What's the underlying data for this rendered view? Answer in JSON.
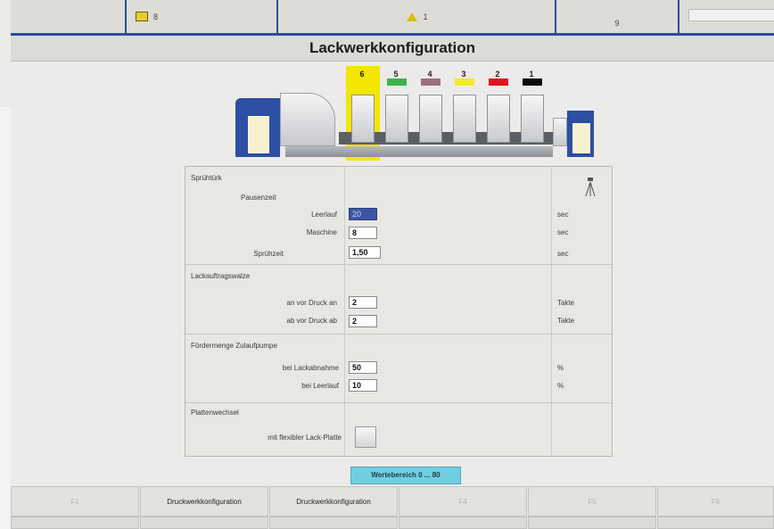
{
  "status_bar": {
    "folder_count": "8",
    "warning_count": "1",
    "counter": "9",
    "folder_icon": "folder-icon",
    "warning_icon": "warning-triangle-icon"
  },
  "page_title": "Lackwerkkonfiguration",
  "press": {
    "units": [
      {
        "number": "6",
        "color": "#f3e600",
        "active": true
      },
      {
        "number": "5",
        "color": "#3cb34a",
        "active": false
      },
      {
        "number": "4",
        "color": "#9c6f7c",
        "active": false
      },
      {
        "number": "3",
        "color": "#f5ea2a",
        "active": false
      },
      {
        "number": "2",
        "color": "#e3111f",
        "active": false
      },
      {
        "number": "1",
        "color": "#0a0a0a",
        "active": false
      }
    ]
  },
  "spray": {
    "header": "Sprühtürk",
    "pause_label": "Pausenzeit",
    "idle_label": "Leerlauf",
    "idle_value": "20",
    "idle_unit": "sec",
    "machine_label": "Maschine",
    "machine_value": "8",
    "machine_unit": "sec",
    "spray_time_label": "Sprühzeit",
    "spray_time_value": "1,50",
    "spray_time_unit": "sec",
    "icon": "spray-nozzle-icon"
  },
  "roller": {
    "header": "Lackauftragswalze",
    "on_label": "an vor Druck an",
    "on_value": "2",
    "on_unit": "Takte",
    "off_label": "ab vor Druck ab",
    "off_value": "2",
    "off_unit": "Takte"
  },
  "pump": {
    "header": "Fördermenge Zulaufpumpe",
    "take_label": "bei Lackabnahme",
    "take_value": "50",
    "take_unit": "%",
    "idle_label": "bei Leerlauf",
    "idle_value": "10",
    "idle_unit": "%"
  },
  "plate": {
    "header": "Plattenwechsel",
    "flex_label": "mit flexibler Lack-Platte"
  },
  "range_text": "Wertebereich 0 ... 80",
  "bottom_buttons": [
    {
      "label": "F1",
      "dim": true
    },
    {
      "label": "Druckwerkkonfiguration",
      "dim": false
    },
    {
      "label": "Druckwerkkonfiguration",
      "dim": false
    },
    {
      "label": "F4",
      "dim": true
    },
    {
      "label": "F5",
      "dim": true
    },
    {
      "label": "F6",
      "dim": true
    }
  ]
}
